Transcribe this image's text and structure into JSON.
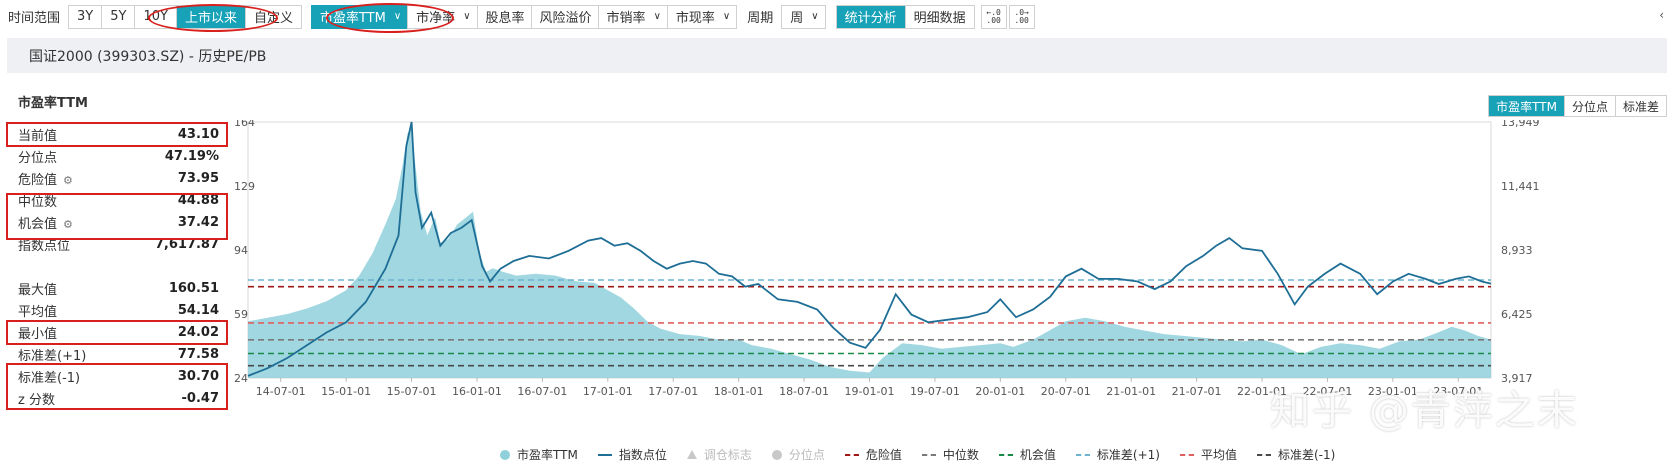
{
  "toolbar": {
    "time_label": "时间范围",
    "ranges": [
      "3Y",
      "5Y",
      "10Y",
      "上市以来",
      "自定义"
    ],
    "active_range": 3,
    "metrics": [
      {
        "label": "市盈率TTM",
        "active": true
      },
      {
        "label": "市净率",
        "active": false
      },
      {
        "label": "股息率",
        "active": false,
        "nodrop": true
      },
      {
        "label": "风险溢价",
        "active": false,
        "nodrop": true
      },
      {
        "label": "市销率",
        "active": false
      },
      {
        "label": "市现率",
        "active": false
      }
    ],
    "period_label": "周期",
    "period_value": "周",
    "views": [
      "统计分析",
      "明细数据"
    ],
    "active_view": 0,
    "decimal_icons": [
      "decrease-decimal-icon",
      "increase-decimal-icon"
    ],
    "right_symbol": "‹"
  },
  "title": "国证2000 (399303.SZ) - 历史PE/PB",
  "stats": {
    "section_title": "市盈率TTM",
    "group1": [
      {
        "k": "当前值",
        "v": "43.10"
      },
      {
        "k": "分位点",
        "v": "47.19%"
      },
      {
        "k": "危险值",
        "v": "73.95",
        "gear": true
      },
      {
        "k": "中位数",
        "v": "44.88"
      },
      {
        "k": "机会值",
        "v": "37.42",
        "gear": true
      },
      {
        "k": "指数点位",
        "v": "7,617.87"
      }
    ],
    "group2": [
      {
        "k": "最大值",
        "v": "160.51"
      },
      {
        "k": "平均值",
        "v": "54.14"
      },
      {
        "k": "最小值",
        "v": "24.02"
      },
      {
        "k": "标准差(+1)",
        "v": "77.58"
      },
      {
        "k": "标准差(-1)",
        "v": "30.70"
      },
      {
        "k": "z 分数",
        "v": "-0.47"
      }
    ]
  },
  "right_tabs": [
    "市盈率TTM",
    "分位点",
    "标准差"
  ],
  "active_right_tab": 0,
  "chart_data": {
    "type": "area",
    "x_ticks": [
      "14-07-01",
      "15-01-01",
      "15-07-01",
      "16-01-01",
      "16-07-01",
      "17-01-01",
      "17-07-01",
      "18-01-01",
      "18-07-01",
      "19-01-01",
      "19-07-01",
      "20-01-01",
      "20-07-01",
      "21-01-01",
      "21-07-01",
      "22-01-01",
      "22-07-01",
      "23-01-01",
      "23-07-01"
    ],
    "y_left_ticks": [
      "164",
      "129",
      "94",
      "59",
      "24"
    ],
    "y_left_range": [
      24,
      164
    ],
    "y_right_ticks": [
      "13,949",
      "11,441",
      "8,933",
      "6,425",
      "3,917"
    ],
    "y_right_range": [
      3917,
      13949
    ],
    "x_range": [
      2014.25,
      2023.75
    ],
    "pe_series": [
      [
        2014.25,
        55
      ],
      [
        2014.4,
        57
      ],
      [
        2014.55,
        59
      ],
      [
        2014.7,
        62
      ],
      [
        2014.85,
        66
      ],
      [
        2015.0,
        72
      ],
      [
        2015.1,
        80
      ],
      [
        2015.2,
        92
      ],
      [
        2015.3,
        108
      ],
      [
        2015.38,
        122
      ],
      [
        2015.43,
        140
      ],
      [
        2015.47,
        158
      ],
      [
        2015.5,
        160
      ],
      [
        2015.53,
        140
      ],
      [
        2015.57,
        115
      ],
      [
        2015.62,
        102
      ],
      [
        2015.68,
        112
      ],
      [
        2015.72,
        98
      ],
      [
        2015.78,
        100
      ],
      [
        2015.85,
        108
      ],
      [
        2015.92,
        112
      ],
      [
        2015.97,
        115
      ],
      [
        2016.02,
        92
      ],
      [
        2016.07,
        82
      ],
      [
        2016.12,
        84
      ],
      [
        2016.2,
        82
      ],
      [
        2016.3,
        80
      ],
      [
        2016.45,
        81
      ],
      [
        2016.6,
        80
      ],
      [
        2016.75,
        77
      ],
      [
        2016.9,
        76
      ],
      [
        2017.0,
        72
      ],
      [
        2017.1,
        68
      ],
      [
        2017.2,
        62
      ],
      [
        2017.3,
        55
      ],
      [
        2017.4,
        51
      ],
      [
        2017.55,
        48
      ],
      [
        2017.7,
        47
      ],
      [
        2017.85,
        45
      ],
      [
        2018.0,
        45
      ],
      [
        2018.1,
        42
      ],
      [
        2018.25,
        40
      ],
      [
        2018.4,
        37
      ],
      [
        2018.55,
        34
      ],
      [
        2018.7,
        30
      ],
      [
        2018.85,
        28
      ],
      [
        2019.0,
        27
      ],
      [
        2019.1,
        35
      ],
      [
        2019.25,
        43
      ],
      [
        2019.4,
        42
      ],
      [
        2019.55,
        40
      ],
      [
        2019.7,
        41
      ],
      [
        2019.85,
        42
      ],
      [
        2020.0,
        43
      ],
      [
        2020.1,
        41
      ],
      [
        2020.25,
        45
      ],
      [
        2020.4,
        51
      ],
      [
        2020.5,
        55
      ],
      [
        2020.65,
        57
      ],
      [
        2020.8,
        55
      ],
      [
        2020.95,
        52
      ],
      [
        2021.1,
        50
      ],
      [
        2021.25,
        48
      ],
      [
        2021.4,
        47
      ],
      [
        2021.55,
        46
      ],
      [
        2021.7,
        45
      ],
      [
        2021.85,
        44
      ],
      [
        2022.0,
        45
      ],
      [
        2022.15,
        42
      ],
      [
        2022.3,
        37
      ],
      [
        2022.45,
        41
      ],
      [
        2022.6,
        43
      ],
      [
        2022.75,
        42
      ],
      [
        2022.9,
        40
      ],
      [
        2023.05,
        44
      ],
      [
        2023.2,
        45
      ],
      [
        2023.35,
        49
      ],
      [
        2023.45,
        52
      ],
      [
        2023.55,
        50
      ],
      [
        2023.65,
        47
      ],
      [
        2023.75,
        45
      ]
    ],
    "index_series": [
      [
        2014.25,
        4000
      ],
      [
        2014.4,
        4300
      ],
      [
        2014.55,
        4700
      ],
      [
        2014.7,
        5200
      ],
      [
        2014.85,
        5700
      ],
      [
        2015.0,
        6100
      ],
      [
        2015.15,
        6900
      ],
      [
        2015.3,
        8200
      ],
      [
        2015.4,
        9500
      ],
      [
        2015.46,
        13000
      ],
      [
        2015.5,
        13950
      ],
      [
        2015.53,
        11200
      ],
      [
        2015.58,
        9800
      ],
      [
        2015.65,
        10400
      ],
      [
        2015.72,
        9100
      ],
      [
        2015.8,
        9600
      ],
      [
        2015.88,
        9800
      ],
      [
        2015.96,
        10100
      ],
      [
        2016.04,
        8300
      ],
      [
        2016.1,
        7700
      ],
      [
        2016.18,
        8200
      ],
      [
        2016.28,
        8500
      ],
      [
        2016.4,
        8700
      ],
      [
        2016.55,
        8600
      ],
      [
        2016.7,
        8900
      ],
      [
        2016.85,
        9300
      ],
      [
        2016.95,
        9400
      ],
      [
        2017.05,
        9100
      ],
      [
        2017.15,
        9200
      ],
      [
        2017.25,
        8900
      ],
      [
        2017.35,
        8500
      ],
      [
        2017.45,
        8200
      ],
      [
        2017.55,
        8400
      ],
      [
        2017.65,
        8500
      ],
      [
        2017.75,
        8400
      ],
      [
        2017.85,
        8000
      ],
      [
        2017.95,
        7900
      ],
      [
        2018.05,
        7500
      ],
      [
        2018.15,
        7600
      ],
      [
        2018.3,
        7000
      ],
      [
        2018.45,
        6900
      ],
      [
        2018.6,
        6600
      ],
      [
        2018.72,
        5900
      ],
      [
        2018.85,
        5300
      ],
      [
        2018.97,
        5100
      ],
      [
        2019.08,
        5800
      ],
      [
        2019.2,
        7200
      ],
      [
        2019.32,
        6400
      ],
      [
        2019.45,
        6100
      ],
      [
        2019.6,
        6200
      ],
      [
        2019.75,
        6300
      ],
      [
        2019.9,
        6500
      ],
      [
        2020.0,
        7000
      ],
      [
        2020.12,
        6300
      ],
      [
        2020.25,
        6600
      ],
      [
        2020.38,
        7100
      ],
      [
        2020.5,
        7900
      ],
      [
        2020.62,
        8200
      ],
      [
        2020.75,
        7800
      ],
      [
        2020.9,
        7800
      ],
      [
        2021.05,
        7700
      ],
      [
        2021.18,
        7400
      ],
      [
        2021.3,
        7700
      ],
      [
        2021.42,
        8300
      ],
      [
        2021.55,
        8700
      ],
      [
        2021.65,
        9100
      ],
      [
        2021.75,
        9400
      ],
      [
        2021.85,
        9000
      ],
      [
        2022.0,
        8900
      ],
      [
        2022.12,
        8000
      ],
      [
        2022.25,
        6800
      ],
      [
        2022.35,
        7500
      ],
      [
        2022.48,
        8000
      ],
      [
        2022.6,
        8400
      ],
      [
        2022.75,
        8000
      ],
      [
        2022.88,
        7200
      ],
      [
        2023.0,
        7700
      ],
      [
        2023.12,
        8000
      ],
      [
        2023.25,
        7800
      ],
      [
        2023.35,
        7600
      ],
      [
        2023.48,
        7800
      ],
      [
        2023.58,
        7900
      ],
      [
        2023.68,
        7700
      ],
      [
        2023.75,
        7618
      ]
    ],
    "ref_lines": [
      {
        "name": "危险值",
        "value": 73.95,
        "color": "#a01818"
      },
      {
        "name": "中位数",
        "value": 44.88,
        "color": "#7a7a7a"
      },
      {
        "name": "机会值",
        "value": 37.42,
        "color": "#1a8a48"
      },
      {
        "name": "标准差(+1)",
        "value": 77.58,
        "color": "#6fb3cf"
      },
      {
        "name": "平均值",
        "value": 54.14,
        "color": "#e06060"
      },
      {
        "name": "标准差(-1)",
        "value": 30.7,
        "color": "#4a4a4a"
      }
    ],
    "colors": {
      "pe_fill": "#8fd0db",
      "index_line": "#1e6e96"
    }
  },
  "legend": [
    {
      "label": "市盈率TTM",
      "kind": "dot",
      "color": "#8fd0db",
      "dim": false
    },
    {
      "label": "指数点位",
      "kind": "line",
      "color": "#1e6e96",
      "dim": false
    },
    {
      "label": "调仓标志",
      "kind": "tri",
      "color": "#c8c8c8",
      "dim": true
    },
    {
      "label": "分位点",
      "kind": "dot",
      "color": "#c8c8c8",
      "dim": true
    },
    {
      "label": "危险值",
      "kind": "dash",
      "color": "#a01818",
      "dim": false
    },
    {
      "label": "中位数",
      "kind": "dash",
      "color": "#7a7a7a",
      "dim": false
    },
    {
      "label": "机会值",
      "kind": "dash",
      "color": "#1a8a48",
      "dim": false
    },
    {
      "label": "标准差(+1)",
      "kind": "dash",
      "color": "#6fb3cf",
      "dim": false
    },
    {
      "label": "平均值",
      "kind": "dash",
      "color": "#e06060",
      "dim": false
    },
    {
      "label": "标准差(-1)",
      "kind": "dash",
      "color": "#4a4a4a",
      "dim": false
    }
  ],
  "watermark": "知乎 @青萍之末"
}
